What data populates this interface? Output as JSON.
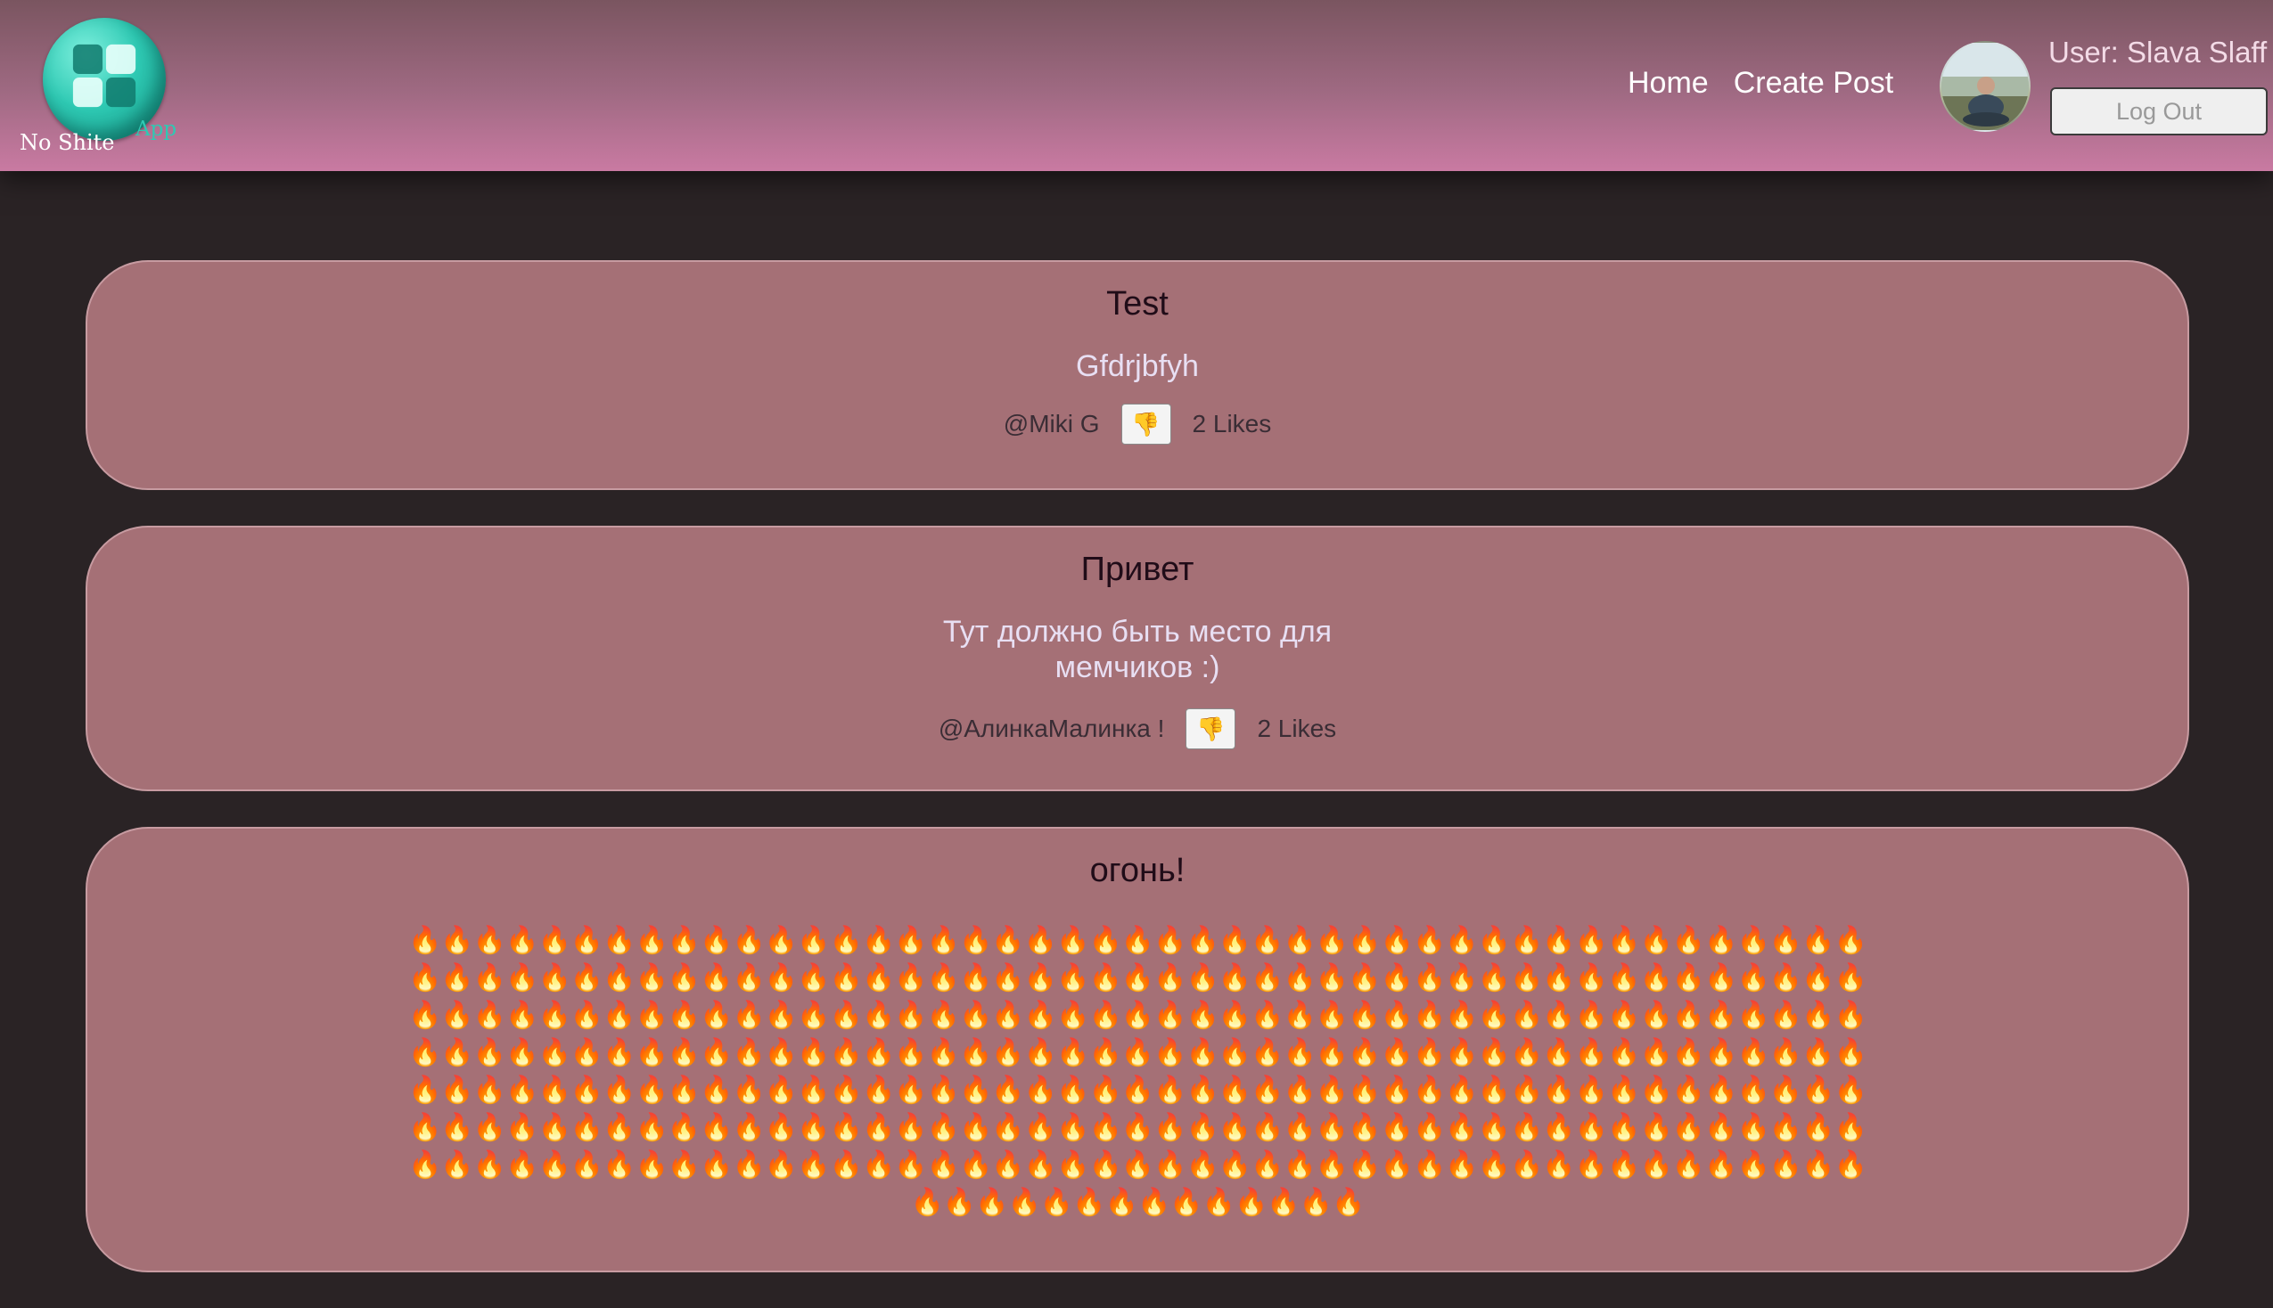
{
  "header": {
    "logo_name": "No Shite",
    "logo_app": "App",
    "nav": [
      {
        "label": "Home"
      },
      {
        "label": "Create Post"
      }
    ],
    "user_label": "User: Slava Slaff",
    "logout_label": "Log Out"
  },
  "posts": [
    {
      "title": "Test",
      "body": "Gfdrjbfyh",
      "author": "@Miki G",
      "dislike_icon": "👎",
      "likes": "2 Likes"
    },
    {
      "title": "Привет",
      "body": "Тут должно быть место для мемчиков :)",
      "author": "@АлинкаМалинка !",
      "dislike_icon": "👎",
      "likes": "2 Likes"
    },
    {
      "title": "огонь!",
      "body": "🔥🔥🔥🔥🔥🔥🔥🔥🔥🔥🔥🔥🔥🔥🔥🔥🔥🔥🔥🔥🔥🔥🔥🔥🔥🔥🔥🔥🔥🔥🔥🔥🔥🔥🔥🔥🔥🔥🔥🔥🔥🔥🔥🔥🔥🔥🔥🔥🔥🔥🔥🔥🔥🔥🔥🔥🔥🔥🔥🔥🔥🔥🔥🔥🔥🔥🔥🔥🔥🔥🔥🔥🔥🔥🔥🔥🔥🔥🔥🔥🔥🔥🔥🔥🔥🔥🔥🔥🔥🔥🔥🔥🔥🔥🔥🔥🔥🔥🔥🔥🔥🔥🔥🔥🔥🔥🔥🔥🔥🔥🔥🔥🔥🔥🔥🔥🔥🔥🔥🔥🔥🔥🔥🔥🔥🔥🔥🔥🔥🔥🔥🔥🔥🔥🔥🔥🔥🔥🔥🔥🔥🔥🔥🔥🔥🔥🔥🔥🔥🔥🔥🔥🔥🔥🔥🔥🔥🔥🔥🔥🔥🔥🔥🔥🔥🔥🔥🔥🔥🔥🔥🔥🔥🔥🔥🔥🔥🔥🔥🔥🔥🔥🔥🔥🔥🔥🔥🔥🔥🔥🔥🔥🔥🔥🔥🔥🔥🔥🔥🔥🔥🔥🔥🔥🔥🔥🔥🔥🔥🔥🔥🔥🔥🔥🔥🔥🔥🔥🔥🔥🔥🔥🔥🔥🔥🔥🔥🔥🔥🔥🔥🔥🔥🔥🔥🔥🔥🔥🔥🔥🔥🔥🔥🔥🔥🔥🔥🔥🔥🔥🔥🔥🔥🔥🔥🔥🔥🔥🔥🔥🔥🔥🔥🔥🔥🔥🔥🔥🔥🔥🔥🔥🔥🔥🔥🔥🔥🔥🔥🔥🔥🔥🔥🔥🔥🔥🔥🔥🔥🔥🔥🔥🔥🔥🔥🔥🔥🔥🔥🔥🔥🔥🔥🔥🔥🔥🔥🔥🔥🔥🔥🔥🔥🔥🔥🔥🔥🔥🔥🔥🔥🔥🔥🔥🔥🔥🔥🔥🔥"
    }
  ],
  "colors": {
    "header_top": "#7a5560",
    "header_bottom": "#c97aa2",
    "page_bg": "#2a2325",
    "card_bg": "#a57076",
    "logo_teal": "#2ec9b3"
  }
}
